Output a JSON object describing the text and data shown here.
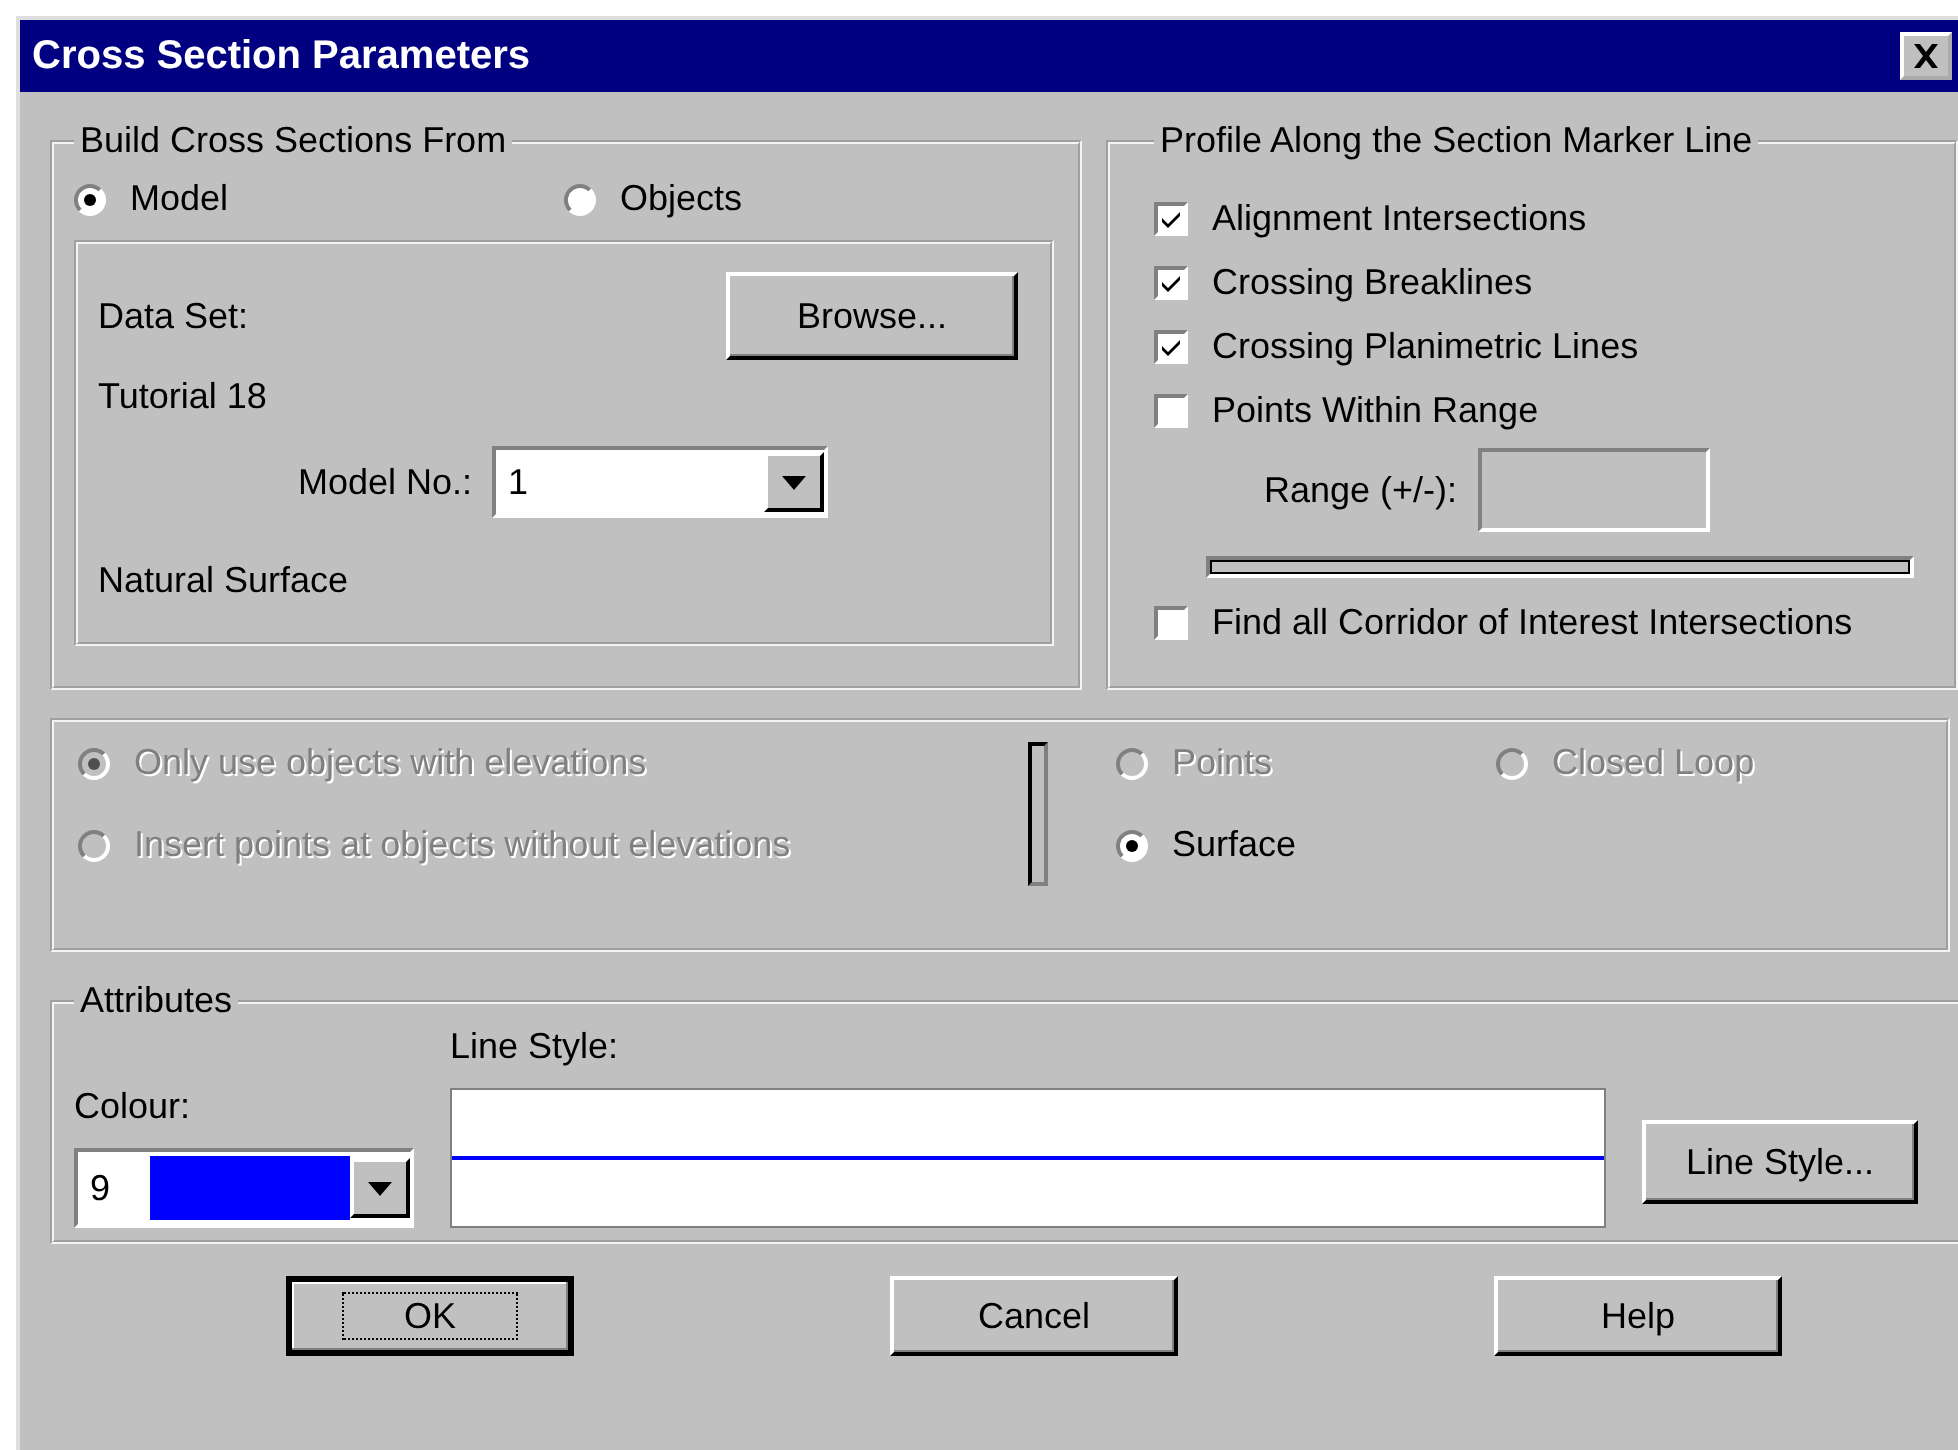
{
  "window": {
    "title": "Cross Section Parameters"
  },
  "build_group": {
    "title": "Build Cross Sections From",
    "sources": [
      {
        "label": "Model",
        "selected": true
      },
      {
        "label": "Objects",
        "selected": false
      }
    ],
    "data_set_label": "Data Set:",
    "browse_button": "Browse...",
    "data_set_value": "Tutorial 18",
    "model_no": {
      "label": "Model No.:",
      "value": "1"
    },
    "surface_name": "Natural Surface"
  },
  "profile_group": {
    "title": "Profile Along the Section Marker Line",
    "options": [
      {
        "label": "Alignment Intersections",
        "checked": true
      },
      {
        "label": "Crossing Breaklines",
        "checked": true
      },
      {
        "label": "Crossing Planimetric Lines",
        "checked": true
      },
      {
        "label": "Points Within Range",
        "checked": false
      }
    ],
    "range_label": "Range (+/-):",
    "corridor": {
      "label": "Find all Corridor of Interest Intersections",
      "checked": false
    }
  },
  "elevation_options": [
    {
      "label": "Only use objects with elevations",
      "selected": true,
      "disabled": true
    },
    {
      "label": "Insert points at objects without elevations",
      "selected": false,
      "disabled": true
    }
  ],
  "point_types": [
    {
      "label": "Points",
      "selected": false,
      "disabled": true
    },
    {
      "label": "Closed Loop",
      "selected": false,
      "disabled": true
    },
    {
      "label": "Surface",
      "selected": true,
      "disabled": false
    }
  ],
  "attributes": {
    "title": "Attributes",
    "colour_label": "Colour:",
    "colour_value": "9",
    "color": "#0000ff",
    "line_style_label": "Line Style:",
    "line_style_button": "Line Style..."
  },
  "buttons": [
    {
      "label": "OK",
      "focused": true
    },
    {
      "label": "Cancel",
      "focused": false
    },
    {
      "label": "Help",
      "focused": false
    }
  ]
}
